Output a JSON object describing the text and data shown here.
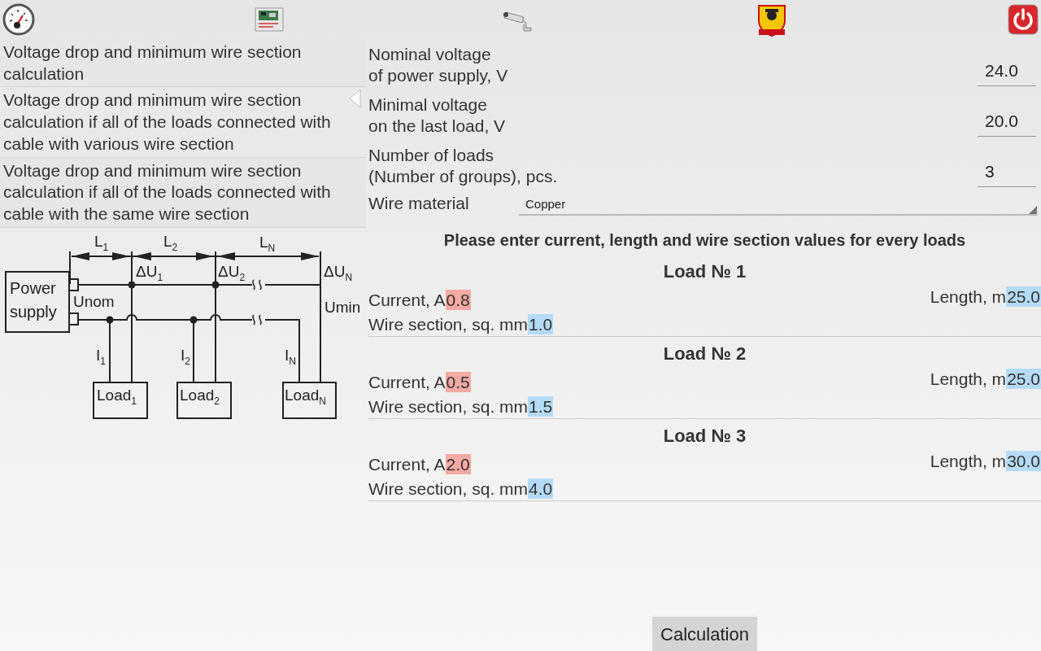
{
  "menu": {
    "items": [
      {
        "label": "Voltage drop and minimum wire section calculation",
        "selected": false
      },
      {
        "label": "Voltage drop and minimum wire section calculation if all of the loads connected with cable with various wire section",
        "selected": true
      },
      {
        "label": "Voltage drop and minimum wire section calculation if all of the loads connected with cable with the same wire section",
        "selected": false
      }
    ]
  },
  "diagram": {
    "labels": [
      "L$_{1}$",
      "L$_{2}$",
      "L$_{N}$",
      "ΔU$_{1}$",
      "ΔU$_{2}$",
      "ΔU$_{N}$",
      "Power supply",
      "Unom",
      "Umin",
      "I$_{1}$",
      "I$_{2}$",
      "I$_{N}$",
      "Load$_{1}$",
      "Load$_{2}$",
      "Load$_{N}$"
    ]
  },
  "form": {
    "fields": [
      {
        "label": "Nominal voltage\nof power supply, V",
        "value": "24.0"
      },
      {
        "label": "Minimal voltage\non the last load, V",
        "value": "20.0"
      },
      {
        "label": "Number of loads\n(Number of groups), pcs.",
        "value": "3"
      }
    ],
    "material": {
      "label": "Wire material",
      "value": "Copper"
    },
    "prompt": "Please enter current, length and wire section values for every loads",
    "loads": [
      {
        "title": "Load № 1",
        "current_label": "Current, A",
        "current": "0.8",
        "length_label": "Length, m",
        "length": "25.0",
        "section_label": "Wire section, sq. mm",
        "section": "1.0"
      },
      {
        "title": "Load № 2",
        "current_label": "Current, A",
        "current": "0.5",
        "length_label": "Length, m",
        "length": "25.0",
        "section_label": "Wire section, sq. mm",
        "section": "1.5"
      },
      {
        "title": "Load № 3",
        "current_label": "Current, A",
        "current": "2.0",
        "length_label": "Length, m",
        "length": "30.0",
        "section_label": "Wire section, sq. mm",
        "section": "4.0"
      }
    ]
  },
  "calculate_button": "Calculation"
}
